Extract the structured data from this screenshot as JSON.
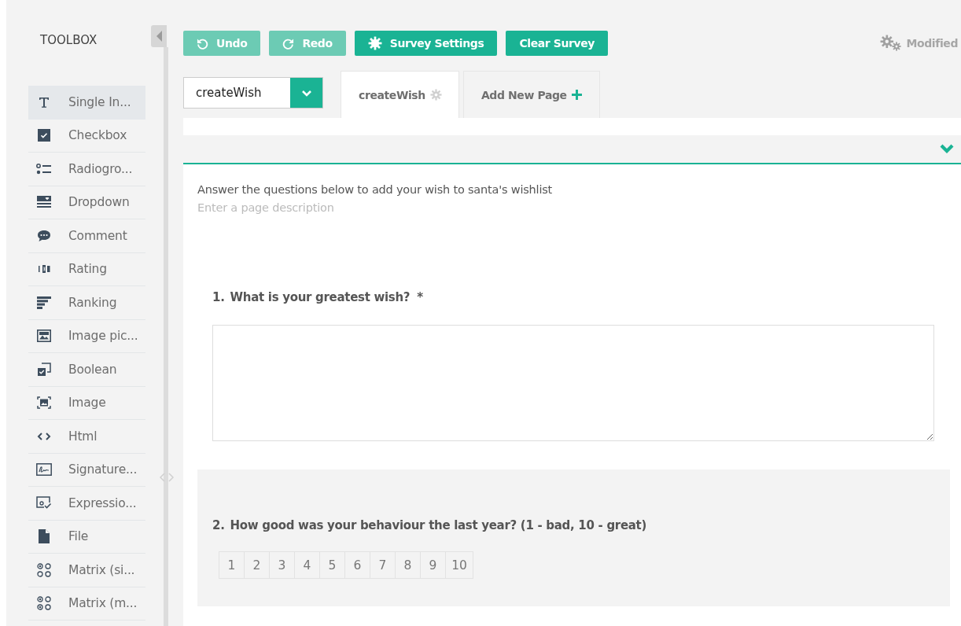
{
  "toolbox": {
    "title": "TOOLBOX",
    "items": [
      {
        "label": "Single In...",
        "selected": true
      },
      {
        "label": "Checkbox",
        "selected": false
      },
      {
        "label": "Radiogro...",
        "selected": false
      },
      {
        "label": "Dropdown",
        "selected": false
      },
      {
        "label": "Comment",
        "selected": false
      },
      {
        "label": "Rating",
        "selected": false
      },
      {
        "label": "Ranking",
        "selected": false
      },
      {
        "label": "Image pic...",
        "selected": false
      },
      {
        "label": "Boolean",
        "selected": false
      },
      {
        "label": "Image",
        "selected": false
      },
      {
        "label": "Html",
        "selected": false
      },
      {
        "label": "Signature...",
        "selected": false
      },
      {
        "label": "Expressio...",
        "selected": false
      },
      {
        "label": "File",
        "selected": false
      },
      {
        "label": "Matrix (si...",
        "selected": false
      },
      {
        "label": "Matrix (m...",
        "selected": false
      }
    ]
  },
  "toolbar": {
    "buttons": [
      {
        "label": "Undo",
        "kind": "undo",
        "disabled": true
      },
      {
        "label": "Redo",
        "kind": "redo",
        "disabled": true
      },
      {
        "label": "Survey Settings",
        "kind": "settings",
        "disabled": false
      },
      {
        "label": "Clear Survey",
        "kind": "plain",
        "disabled": false
      }
    ],
    "status": "Modified"
  },
  "pages": {
    "dropdown": {
      "value": "createWish"
    },
    "tabs": [
      {
        "label": "createWish",
        "kind": "page",
        "selected": true
      },
      {
        "label": "Add New Page",
        "kind": "add",
        "selected": false
      }
    ]
  },
  "page": {
    "title": "Answer the questions below to add your wish to santa's wishlist",
    "description": {
      "placeholder": "Enter a page description"
    },
    "questions": [
      {
        "number": "1.",
        "title": "What is your greatest wish?",
        "required_mark": "*",
        "kind": "comment",
        "selected": false
      },
      {
        "number": "2.",
        "title": "How good was your behaviour the last year? (1 - bad, 10 - great)",
        "kind": "rating",
        "selected": true,
        "options": [
          "1",
          "2",
          "3",
          "4",
          "5",
          "6",
          "7",
          "8",
          "9",
          "10"
        ]
      }
    ]
  }
}
